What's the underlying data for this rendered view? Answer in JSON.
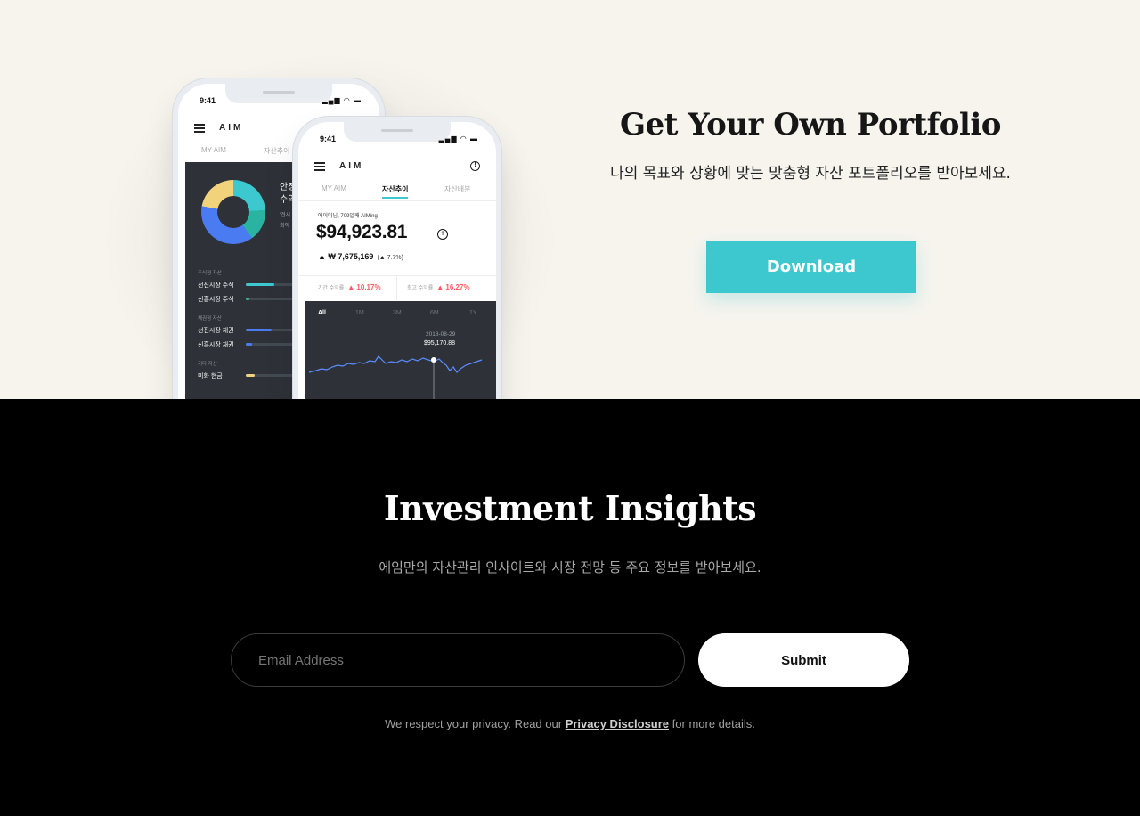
{
  "hero": {
    "title": "Get Your Own Portfolio",
    "subtitle": "나의 목표와 상황에 맞는 맞춤형 자산 포트폴리오를 받아보세요.",
    "download_label": "Download",
    "accent_color": "#3cc8ce",
    "background_color": "#f7f4ee"
  },
  "phone_back": {
    "time": "9:41",
    "app_name": "AIM",
    "tabs": [
      "MY AIM",
      "자산추이"
    ],
    "side_text": [
      "안정",
      "수익"
    ],
    "side_subtext": [
      "'견시",
      "최적"
    ],
    "list": [
      {
        "group": "주식형 자산",
        "items": [
          {
            "label": "선진시장 주식",
            "color": "#3cc8ce",
            "fill": 0.58
          },
          {
            "label": "신흥시장 주식",
            "color": "#2bb3a2",
            "fill": 0.08
          }
        ]
      },
      {
        "group": "채권형 자산",
        "items": [
          {
            "label": "선진시장 채권",
            "color": "#4a7bf0",
            "fill": 0.52
          },
          {
            "label": "신흥시장 채권",
            "color": "#4a7bf0",
            "fill": 0.12
          }
        ]
      },
      {
        "group": "기타 자산",
        "items": [
          {
            "label": "미화 현금",
            "color": "#f2d27a",
            "fill": 0.18
          }
        ]
      }
    ]
  },
  "phone_front": {
    "time": "9:41",
    "app_name": "AIM",
    "tabs": [
      "MY AIM",
      "자산추이",
      "자산배분"
    ],
    "active_tab": "자산추이",
    "greeting": "에이미님, 709일째 AIMing",
    "amount": "$94,923.81",
    "gain": "▲ ₩ 7,675,169",
    "gain_pct": "(▲ 7.7%)",
    "period_return_label": "기간 수익률",
    "period_return_value": "▲ 10.17%",
    "max_return_label": "최고 수익률",
    "max_return_value": "▲ 16.27%",
    "ranges": [
      "All",
      "1M",
      "3M",
      "6M",
      "1Y"
    ],
    "active_range": "All",
    "tooltip_date": "2018-08-29",
    "tooltip_value": "$95,170.88"
  },
  "insights": {
    "title": "Investment Insights",
    "subtitle": "에임만의 자산관리 인사이트와 시장 전망 등 주요 정보를 받아보세요.",
    "email_placeholder": "Email Address",
    "submit_label": "Submit",
    "privacy_prefix": "We respect your privacy. Read our ",
    "privacy_link": "Privacy Disclosure",
    "privacy_suffix": " for more details."
  }
}
